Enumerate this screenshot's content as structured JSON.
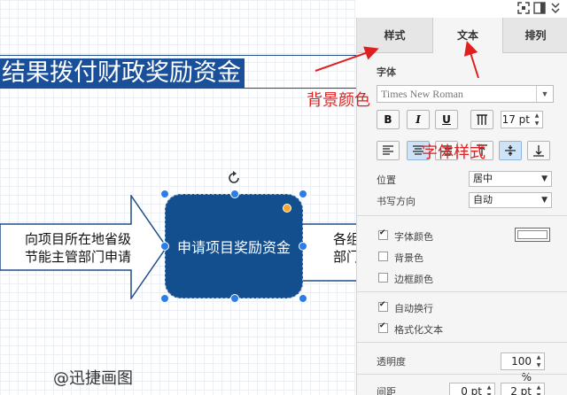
{
  "canvas": {
    "title_text": "结果拨付财政奖励资金",
    "left_arrow_line1": "向项目所在地省级",
    "left_arrow_line2": "节能主管部门申请",
    "process_box_text": "申请项目奖励资金",
    "right_arrow_line1": "各组",
    "right_arrow_line2": "部门",
    "watermark": "@迅捷画图"
  },
  "annotations": {
    "background_color_note": "背景颜色",
    "font_style_note": "字体样式",
    "color": "#e02020"
  },
  "panel": {
    "tabs": [
      {
        "label": "样式"
      },
      {
        "label": "文本"
      },
      {
        "label": "排列"
      }
    ],
    "font_section_label": "字体",
    "font_family_value": "Times New Roman",
    "bold_label": "B",
    "italic_label": "I",
    "underline_label": "U",
    "font_size_value": "17 pt",
    "position_label": "位置",
    "position_value": "居中",
    "writing_direction_label": "书写方向",
    "writing_direction_value": "自动",
    "font_color_label": "字体颜色",
    "background_label": "背景色",
    "border_color_label": "边框颜色",
    "auto_wrap_label": "自动换行",
    "formatted_text_label": "格式化文本",
    "opacity_label": "透明度",
    "opacity_value": "100 %",
    "spacing_label": "间距",
    "spacing_value_1": "0 pt",
    "spacing_value_2": "2 pt"
  },
  "checkbox_states": {
    "font_color": true,
    "background": false,
    "border_color": false,
    "auto_wrap": true,
    "formatted_text": true
  },
  "colors": {
    "shape_fill": "#134e8e",
    "title_fill": "#1a4f9a",
    "selection_handle": "#2b7de9",
    "active_button": "#cfe3f7"
  }
}
